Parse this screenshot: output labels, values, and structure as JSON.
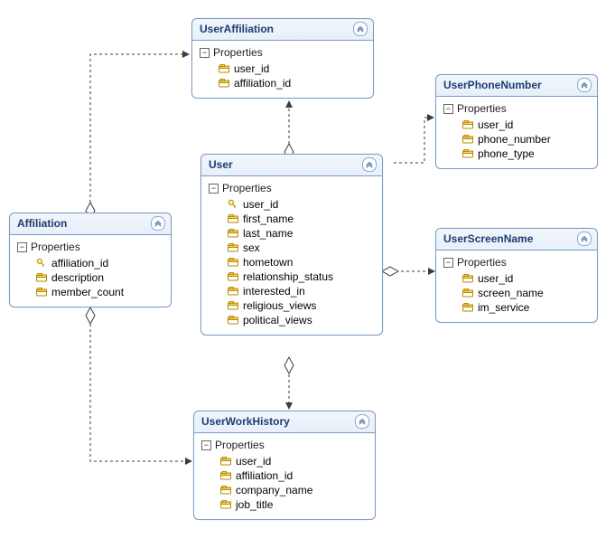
{
  "section_label": "Properties",
  "entities": {
    "userAffiliation": {
      "title": "UserAffiliation",
      "props": [
        "user_id",
        "affiliation_id"
      ],
      "keys": []
    },
    "userPhoneNumber": {
      "title": "UserPhoneNumber",
      "props": [
        "user_id",
        "phone_number",
        "phone_type"
      ],
      "keys": []
    },
    "user": {
      "title": "User",
      "props": [
        "user_id",
        "first_name",
        "last_name",
        "sex",
        "hometown",
        "relationship_status",
        "interested_in",
        "religious_views",
        "political_views"
      ],
      "keys": [
        "user_id"
      ]
    },
    "affiliation": {
      "title": "Affiliation",
      "props": [
        "affiliation_id",
        "description",
        "member_count"
      ],
      "keys": [
        "affiliation_id"
      ]
    },
    "userScreenName": {
      "title": "UserScreenName",
      "props": [
        "user_id",
        "screen_name",
        "im_service"
      ],
      "keys": []
    },
    "userWorkHistory": {
      "title": "UserWorkHistory",
      "props": [
        "user_id",
        "affiliation_id",
        "company_name",
        "job_title"
      ],
      "keys": []
    }
  }
}
